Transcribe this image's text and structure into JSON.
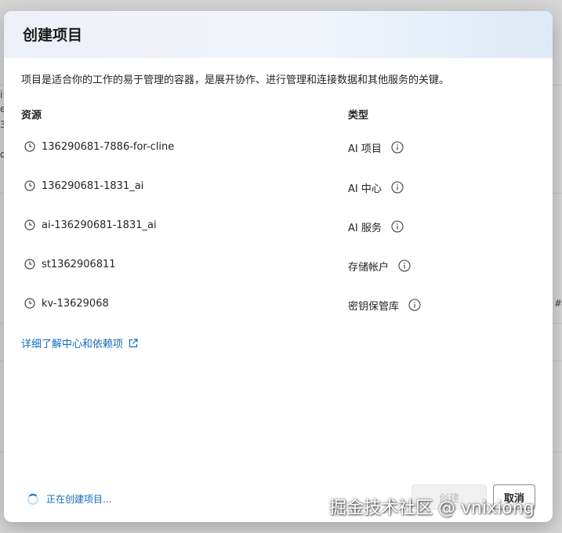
{
  "dialog": {
    "title": "创建项目",
    "description": "项目是适合你的工作的易于管理的容器，是展开协作、进行管理和连接数据和其他服务的关键。",
    "columns": {
      "resource": "资源",
      "type": "类型"
    },
    "rows": [
      {
        "resource": "136290681-7886-for-cline",
        "type": "AI 项目"
      },
      {
        "resource": "136290681-1831_ai",
        "type": "AI 中心"
      },
      {
        "resource": "ai-136290681-1831_ai",
        "type": "AI 服务"
      },
      {
        "resource": "st1362906811",
        "type": "存储帐户"
      },
      {
        "resource": "kv-13629068",
        "type": "密钥保管库"
      }
    ],
    "learn_more_link": "详细了解中心和依赖项",
    "status": "正在创建项目...",
    "create_label": "创建",
    "cancel_label": "取消"
  },
  "background_fragments": [
    "i:",
    "e",
    "3",
    "o",
    "#"
  ],
  "watermark": "掘金技术社区 @ vnixiong",
  "colors": {
    "accent": "#0f6cbd",
    "text": "#242424",
    "disabled": "#bdbdbd"
  }
}
